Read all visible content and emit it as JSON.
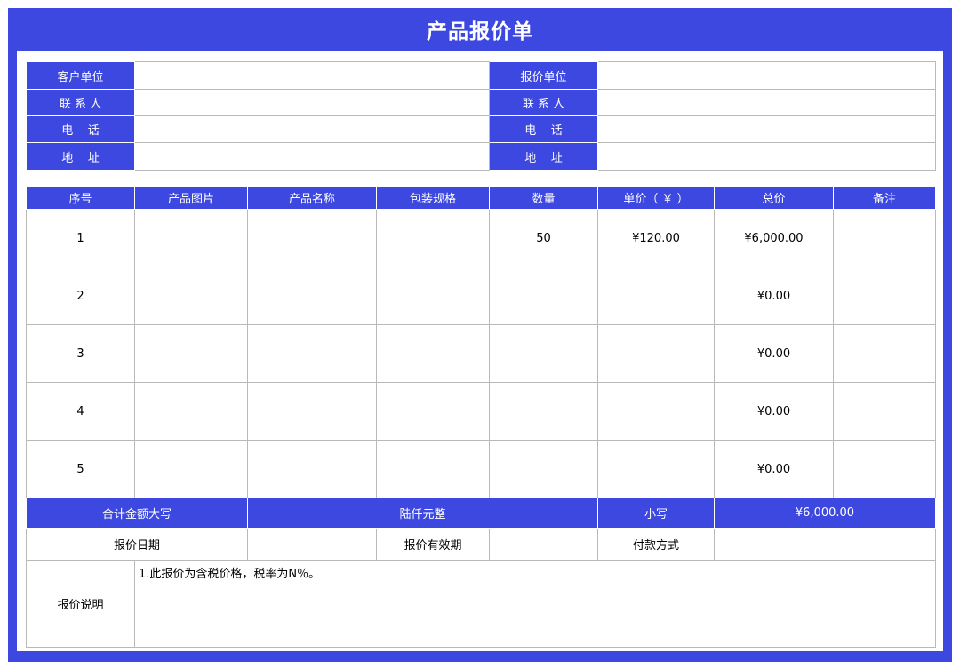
{
  "title": "产品报价单",
  "info": {
    "left_labels": [
      "客户单位",
      "联 系 人",
      "电    话",
      "地    址"
    ],
    "right_labels": [
      "报价单位",
      "联 系 人",
      "电    话",
      "地    址"
    ],
    "left_values": [
      "",
      "",
      "",
      ""
    ],
    "right_values": [
      "",
      "",
      "",
      ""
    ]
  },
  "items": {
    "headers": [
      "序号",
      "产品图片",
      "产品名称",
      "包装规格",
      "数量",
      "单价（ ￥ ）",
      "总价",
      "备注"
    ],
    "rows": [
      {
        "no": "1",
        "image": "",
        "name": "",
        "spec": "",
        "qty": "50",
        "price": "¥120.00",
        "total": "¥6,000.00",
        "remark": ""
      },
      {
        "no": "2",
        "image": "",
        "name": "",
        "spec": "",
        "qty": "",
        "price": "",
        "total": "¥0.00",
        "remark": ""
      },
      {
        "no": "3",
        "image": "",
        "name": "",
        "spec": "",
        "qty": "",
        "price": "",
        "total": "¥0.00",
        "remark": ""
      },
      {
        "no": "4",
        "image": "",
        "name": "",
        "spec": "",
        "qty": "",
        "price": "",
        "total": "¥0.00",
        "remark": ""
      },
      {
        "no": "5",
        "image": "",
        "name": "",
        "spec": "",
        "qty": "",
        "price": "",
        "total": "¥0.00",
        "remark": ""
      }
    ]
  },
  "totals": {
    "upper_label": "合计金额大写",
    "upper_value": "陆仟元整",
    "lower_label": "小写",
    "lower_value": "¥6,000.00"
  },
  "meta": {
    "date_label": "报价日期",
    "date_value": "",
    "validity_label": "报价有效期",
    "validity_value": "",
    "payment_label": "付款方式",
    "payment_value": ""
  },
  "notes": {
    "label": "报价说明",
    "text": "1.此报价为含税价格，税率为N％。"
  }
}
